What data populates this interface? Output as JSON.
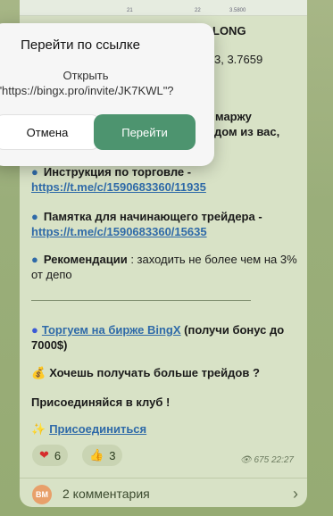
{
  "chart_strip": {
    "tick1": "21",
    "tick2": "22",
    "tick3": "3.5800"
  },
  "post": {
    "partial_line1": "LONG",
    "partial_line2": "3, 3.7659",
    "partial_line3": "маржу",
    "partial_line4": "дом из вас,",
    "instruction_label": "Инструкция по торговле - ",
    "instruction_link": "https://t.me/c/1590683360/11935",
    "memo_label": "Памятка для начинающего трейдера - ",
    "memo_link": "https://t.me/c/1590683360/15635",
    "recommend_label": "Рекомендации",
    "recommend_text": " : заходить не более чем на 3% от депо",
    "trade_link": "Торгуем на бирже BingX",
    "trade_bonus": "  (получи бонус до 7000$)",
    "more_trades": "Хочешь получать больше трейдов ?",
    "join_club": "Присоединяйся в клуб !",
    "join_link": "Присоединиться"
  },
  "reactions": [
    {
      "icon": "heart-icon",
      "count": "6"
    },
    {
      "icon": "thumbs-up-icon",
      "count": "3"
    }
  ],
  "meta": {
    "views": "675",
    "time": "22:27"
  },
  "comments": {
    "avatar_initials": "BM",
    "label": "2 комментария"
  },
  "dialog": {
    "title": "Перейти по ссылке",
    "body": "Открыть \"https://bingx.pro/invite/JK7KWL\"?",
    "cancel": "Отмена",
    "confirm": "Перейти"
  }
}
